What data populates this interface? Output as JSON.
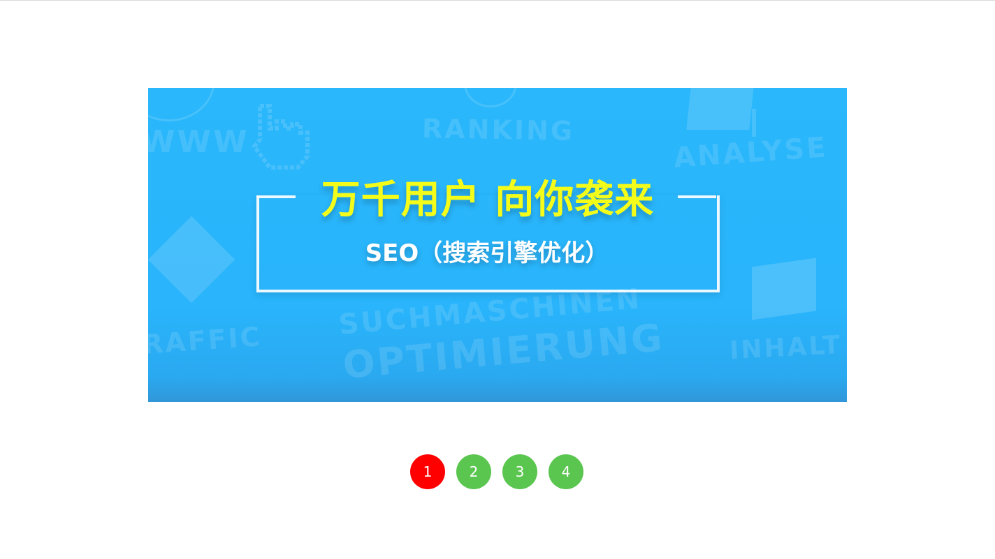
{
  "banner": {
    "headline": "万千用户 向你袭来",
    "subline": "SEO（搜索引擎优化）",
    "background_words": {
      "ranking": "RANKING",
      "analyse": "ANALYSE",
      "www": "WWW",
      "traffic": "RAFFIC",
      "suchmaschinen": "SUCHMASCHINEN",
      "optimierung": "OPTIMIERUNG",
      "inhalt": "INHALT"
    },
    "colors": {
      "background": "#29b4fb",
      "headline": "#f4fc1a",
      "frame": "#ffffff"
    },
    "icons": [
      "pointer-hand-icon",
      "diamond-icon",
      "box-icon",
      "monitor-icon"
    ]
  },
  "pager": {
    "active_index": 1,
    "colors": {
      "active": "#ff0000",
      "inactive": "#5ac54f"
    },
    "items": [
      {
        "label": "1"
      },
      {
        "label": "2"
      },
      {
        "label": "3"
      },
      {
        "label": "4"
      }
    ]
  }
}
